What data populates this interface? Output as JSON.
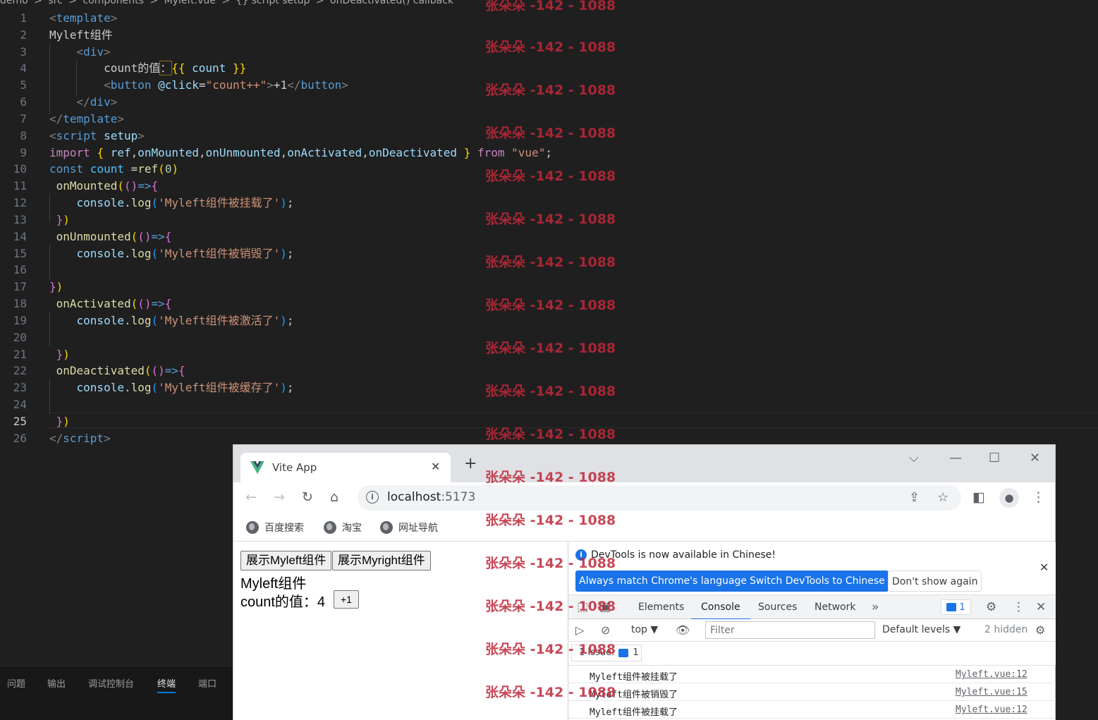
{
  "editor": {
    "breadcrumb": [
      "demo",
      ">",
      "src",
      ">",
      "components",
      ">",
      "Myleft.vue",
      ">",
      "{} script setup",
      ">",
      "onDeactivated() callback"
    ],
    "active_line": 25
  },
  "panel_tabs": [
    "问题",
    "输出",
    "调试控制台",
    "终端",
    "端口"
  ],
  "watermark": "张朵朵 -142 - 1088",
  "browser": {
    "tab_title": "Vite App",
    "url_host": "localhost",
    "url_port": ":5173",
    "bookmarks": [
      "百度搜索",
      "淘宝",
      "网址导航"
    ]
  },
  "page": {
    "buttons": [
      "展示Myleft组件",
      "展示Myright组件"
    ],
    "heading": "Myleft组件",
    "count_text": "count的值：4",
    "plus_label": "+1"
  },
  "devtools": {
    "banner_text": "DevTools is now available in Chinese!",
    "banner_buttons": [
      "Always match Chrome's language",
      "Switch DevTools to Chinese",
      "Don't show again"
    ],
    "tabs": [
      "Elements",
      "Console",
      "Sources",
      "Network"
    ],
    "active_tab": "Console",
    "issue_count": "1",
    "context": "top ▼",
    "filter_placeholder": "Filter",
    "levels": "Default levels ▼",
    "hidden": "2 hidden",
    "issues_label": "1 Issue:",
    "logs": [
      {
        "message": "Myleft组件被挂载了",
        "source": "Myleft.vue:12"
      },
      {
        "message": "Myleft组件被销毁了",
        "source": "Myleft.vue:15"
      },
      {
        "message": "Myleft组件被挂载了",
        "source": "Myleft.vue:12"
      }
    ]
  },
  "colors": {
    "accent": "#1a73e8",
    "watermark": "#c0283a",
    "editor_bg": "#1f1f1f"
  }
}
